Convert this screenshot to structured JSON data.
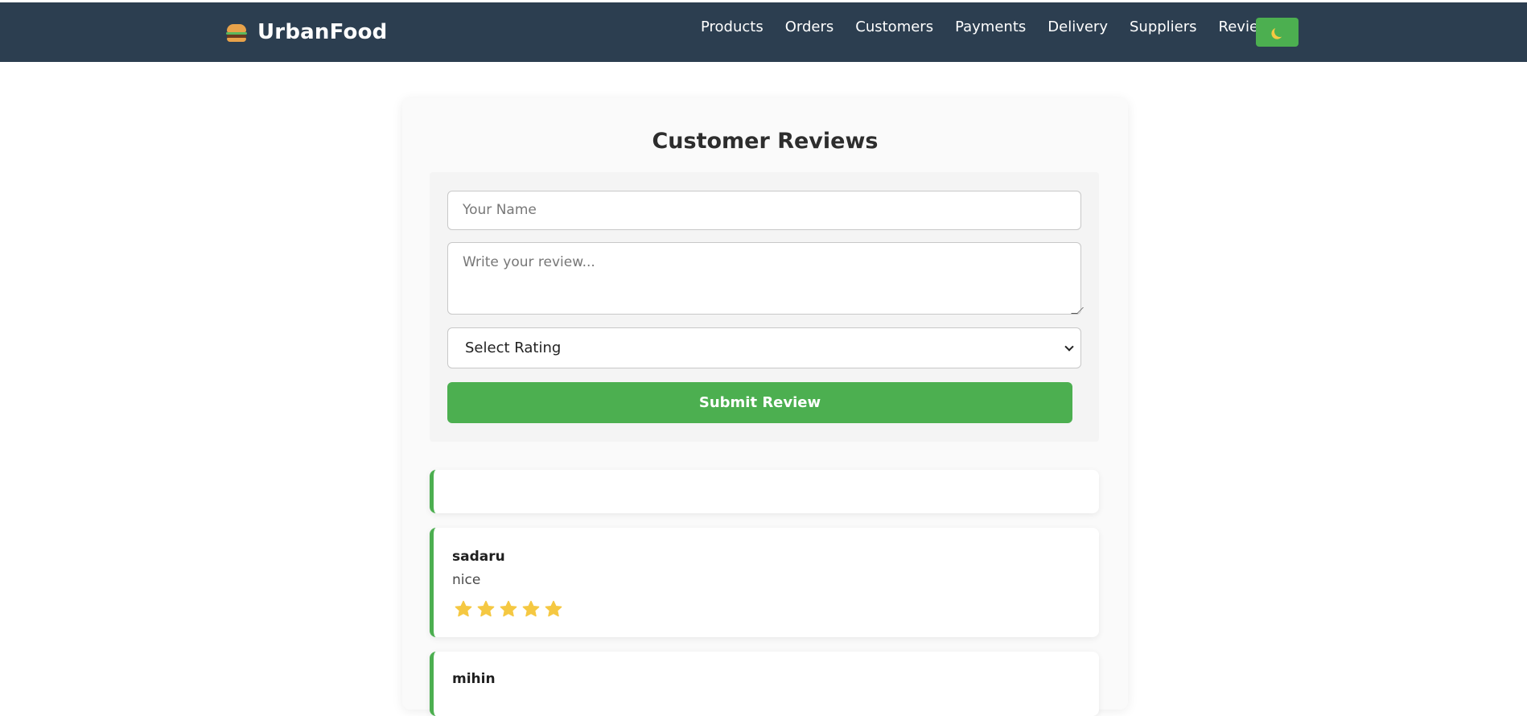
{
  "brand": {
    "name": "UrbanFood",
    "icon": "burger-icon"
  },
  "nav": {
    "links": [
      "Products",
      "Orders",
      "Customers",
      "Payments",
      "Delivery",
      "Suppliers",
      "Reviews"
    ],
    "theme_toggle_icon": "moon-icon"
  },
  "page": {
    "title": "Customer Reviews"
  },
  "form": {
    "name_placeholder": "Your Name",
    "review_placeholder": "Write your review...",
    "rating_selected": "Select Rating",
    "submit_label": "Submit Review"
  },
  "reviews": [
    {
      "name": "",
      "comment": "",
      "rating": 0
    },
    {
      "name": "sadaru",
      "comment": "nice",
      "rating": 5
    },
    {
      "name": "mihin",
      "comment": "",
      "rating": 0
    }
  ],
  "colors": {
    "navbar": "#2c3e50",
    "accent": "#4caf50",
    "star": "#f5c842"
  }
}
